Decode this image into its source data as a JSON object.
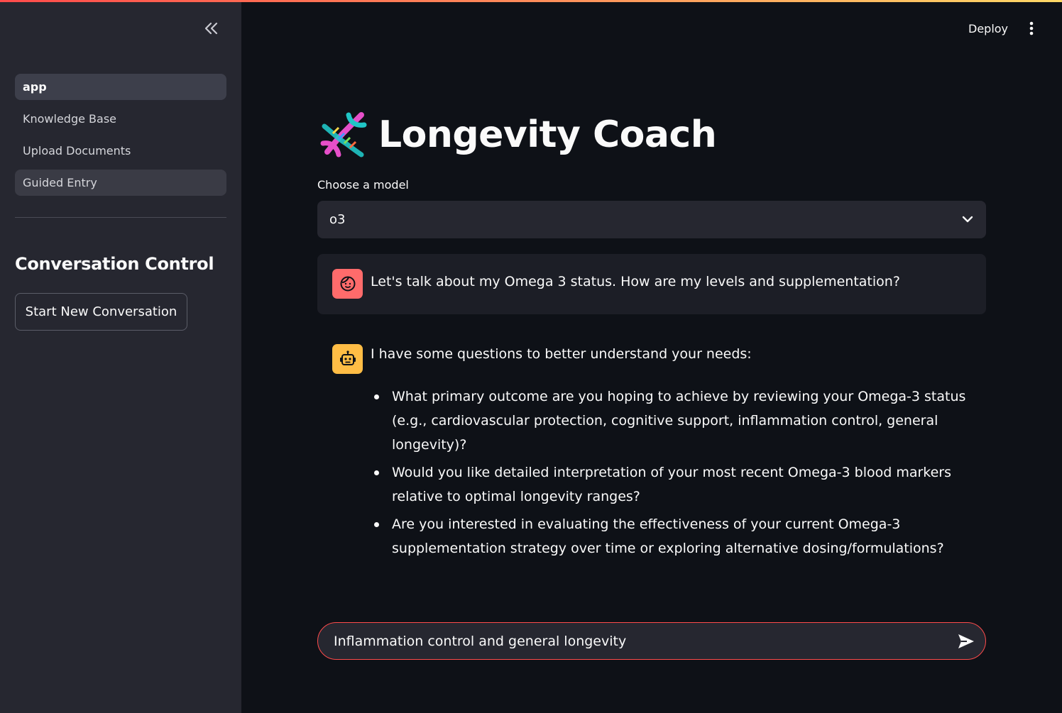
{
  "sidebar": {
    "nav_items": [
      {
        "label": "app",
        "active": true
      },
      {
        "label": "Knowledge Base",
        "active": false
      },
      {
        "label": "Upload Documents",
        "active": false
      },
      {
        "label": "Guided Entry",
        "active": false
      }
    ],
    "section_heading": "Conversation Control",
    "start_button_label": "Start New Conversation"
  },
  "header": {
    "deploy_label": "Deploy"
  },
  "main": {
    "title_icon": "dna-icon",
    "title": "Longevity Coach",
    "model_select": {
      "label": "Choose a model",
      "value": "o3"
    },
    "messages": [
      {
        "role": "user",
        "avatar_icon": "user-face-icon",
        "text": "Let's talk about my Omega 3 status. How are my levels and supplementation?"
      },
      {
        "role": "assistant",
        "avatar_icon": "robot-icon",
        "intro": "I have some questions to better understand your needs:",
        "bullets": [
          "What primary outcome are you hoping to achieve by reviewing your Omega-3 status (e.g., cardiovascular protection, cognitive support, inflammation control, general longevity)?",
          "Would you like detailed interpretation of your most recent Omega-3 blood markers relative to optimal longevity ranges?",
          "Are you interested in evaluating the effectiveness of your current Omega-3 supplementation strategy over time or exploring alternative dosing/formulations?"
        ]
      }
    ],
    "chat_input": {
      "value": "Inflammation control and general longevity"
    }
  },
  "colors": {
    "background": "#0e1117",
    "sidebar": "#262730",
    "accent": "#ff4b4b",
    "user_avatar": "#ff6b6b",
    "bot_avatar": "#ffbd45"
  }
}
